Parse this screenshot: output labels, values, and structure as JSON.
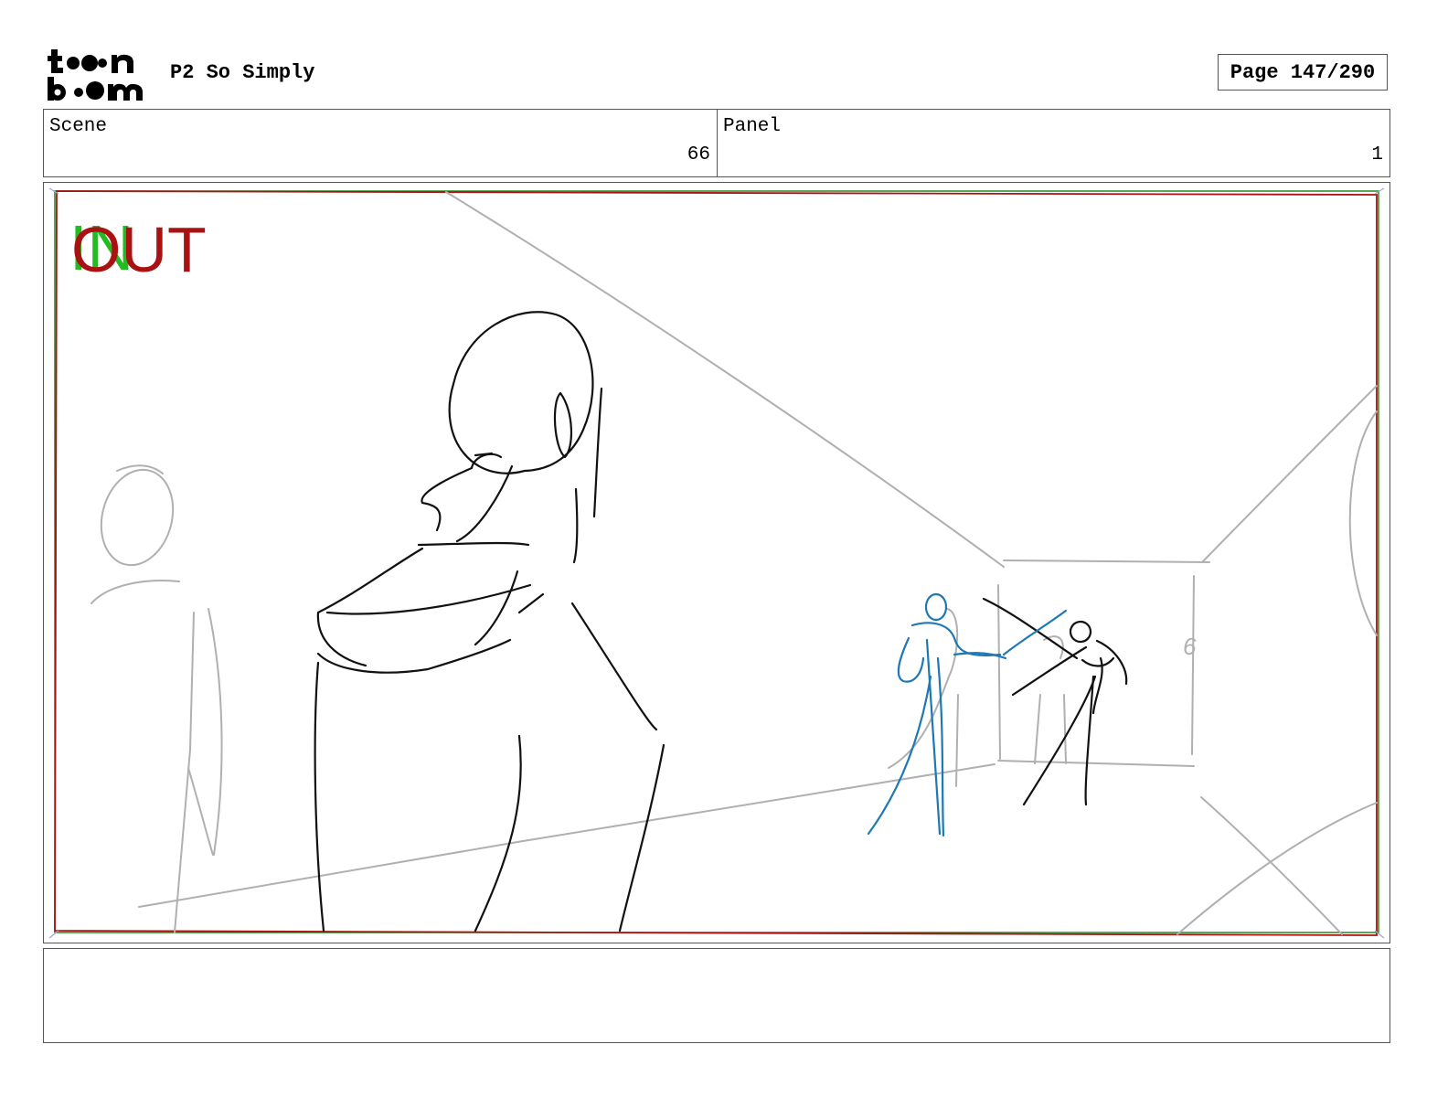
{
  "header": {
    "logo_top": "t●●n",
    "logo_bottom": "b●●m",
    "project_title": "P2 So Simply",
    "page_indicator": "Page 147/290"
  },
  "info": {
    "scene_label": "Scene",
    "scene_value": "66",
    "panel_label": "Panel",
    "panel_value": "1"
  },
  "panel": {
    "in_marker": "IN",
    "out_marker": "OUT",
    "sketch_digit": "6",
    "colors": {
      "in_marker": "#22bb22",
      "out_marker": "#aa1111",
      "safe_frame_red": "#aa1111",
      "safe_frame_green": "#228822",
      "sketch_black": "#111111",
      "sketch_gray": "#b0b0b0",
      "sketch_blue": "#1e78b4"
    }
  },
  "notes": {
    "text": ""
  }
}
